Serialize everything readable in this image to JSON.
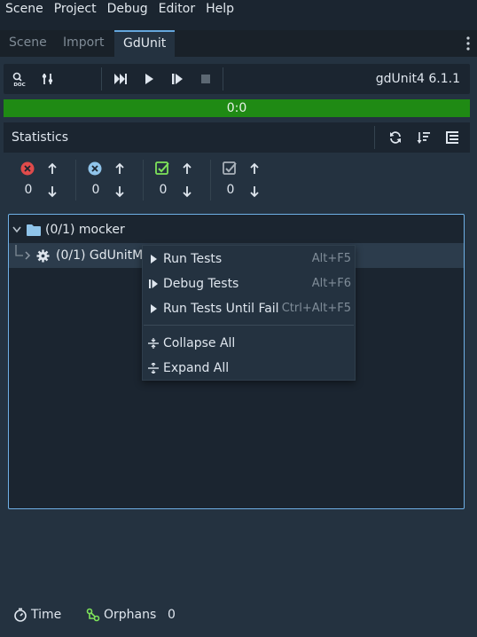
{
  "menubar": {
    "items": [
      "Scene",
      "Project",
      "Debug",
      "Editor",
      "Help"
    ]
  },
  "tabs": [
    {
      "label": "Scene",
      "active": false
    },
    {
      "label": "Import",
      "active": false
    },
    {
      "label": "GdUnit",
      "active": true
    }
  ],
  "toolbar": {
    "version": "gdUnit4 6.1.1"
  },
  "progress": {
    "text": "0:0",
    "fill_percent": 100,
    "color": "#1f8a14"
  },
  "statistics": {
    "title": "Statistics",
    "counters": [
      {
        "icon": "error-icon",
        "value": "0",
        "color": "#e04b4b"
      },
      {
        "icon": "failure-icon",
        "value": "0",
        "color": "#8fc4ea"
      },
      {
        "icon": "passed-icon",
        "value": "0",
        "color": "#7ee35a"
      },
      {
        "icon": "skipped-icon",
        "value": "0",
        "color": "#a8b0b8"
      }
    ]
  },
  "tree": {
    "root": {
      "label": "(0/1) mocker"
    },
    "child": {
      "label": "(0/1) GdUnitMc"
    }
  },
  "context_menu": {
    "items": [
      {
        "label": "Run Tests",
        "shortcut": "Alt+F5"
      },
      {
        "label": "Debug Tests",
        "shortcut": "Alt+F6"
      },
      {
        "label": "Run Tests Until Fail",
        "shortcut": "Ctrl+Alt+F5"
      },
      {
        "label": "Collapse All",
        "shortcut": ""
      },
      {
        "label": "Expand All",
        "shortcut": ""
      }
    ]
  },
  "footer": {
    "time_label": "Time",
    "orphans_label": "Orphans",
    "orphans_value": "0"
  },
  "colors": {
    "accent": "#64a6dc",
    "panel": "#243240",
    "background": "#1b2530"
  }
}
